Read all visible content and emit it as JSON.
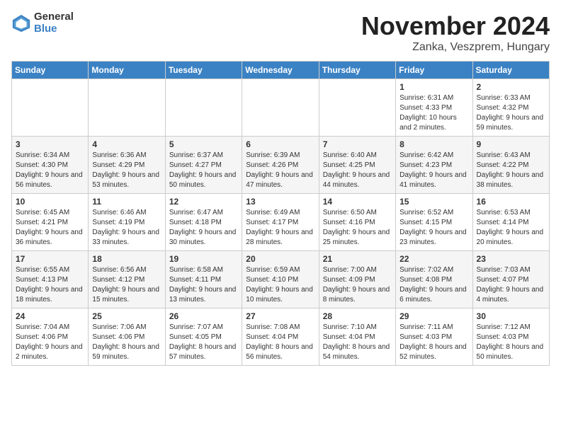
{
  "logo": {
    "general": "General",
    "blue": "Blue"
  },
  "title": {
    "month": "November 2024",
    "location": "Zanka, Veszprem, Hungary"
  },
  "headers": [
    "Sunday",
    "Monday",
    "Tuesday",
    "Wednesday",
    "Thursday",
    "Friday",
    "Saturday"
  ],
  "weeks": [
    [
      {
        "day": "",
        "sunrise": "",
        "sunset": "",
        "daylight": ""
      },
      {
        "day": "",
        "sunrise": "",
        "sunset": "",
        "daylight": ""
      },
      {
        "day": "",
        "sunrise": "",
        "sunset": "",
        "daylight": ""
      },
      {
        "day": "",
        "sunrise": "",
        "sunset": "",
        "daylight": ""
      },
      {
        "day": "",
        "sunrise": "",
        "sunset": "",
        "daylight": ""
      },
      {
        "day": "1",
        "sunrise": "Sunrise: 6:31 AM",
        "sunset": "Sunset: 4:33 PM",
        "daylight": "Daylight: 10 hours and 2 minutes."
      },
      {
        "day": "2",
        "sunrise": "Sunrise: 6:33 AM",
        "sunset": "Sunset: 4:32 PM",
        "daylight": "Daylight: 9 hours and 59 minutes."
      }
    ],
    [
      {
        "day": "3",
        "sunrise": "Sunrise: 6:34 AM",
        "sunset": "Sunset: 4:30 PM",
        "daylight": "Daylight: 9 hours and 56 minutes."
      },
      {
        "day": "4",
        "sunrise": "Sunrise: 6:36 AM",
        "sunset": "Sunset: 4:29 PM",
        "daylight": "Daylight: 9 hours and 53 minutes."
      },
      {
        "day": "5",
        "sunrise": "Sunrise: 6:37 AM",
        "sunset": "Sunset: 4:27 PM",
        "daylight": "Daylight: 9 hours and 50 minutes."
      },
      {
        "day": "6",
        "sunrise": "Sunrise: 6:39 AM",
        "sunset": "Sunset: 4:26 PM",
        "daylight": "Daylight: 9 hours and 47 minutes."
      },
      {
        "day": "7",
        "sunrise": "Sunrise: 6:40 AM",
        "sunset": "Sunset: 4:25 PM",
        "daylight": "Daylight: 9 hours and 44 minutes."
      },
      {
        "day": "8",
        "sunrise": "Sunrise: 6:42 AM",
        "sunset": "Sunset: 4:23 PM",
        "daylight": "Daylight: 9 hours and 41 minutes."
      },
      {
        "day": "9",
        "sunrise": "Sunrise: 6:43 AM",
        "sunset": "Sunset: 4:22 PM",
        "daylight": "Daylight: 9 hours and 38 minutes."
      }
    ],
    [
      {
        "day": "10",
        "sunrise": "Sunrise: 6:45 AM",
        "sunset": "Sunset: 4:21 PM",
        "daylight": "Daylight: 9 hours and 36 minutes."
      },
      {
        "day": "11",
        "sunrise": "Sunrise: 6:46 AM",
        "sunset": "Sunset: 4:19 PM",
        "daylight": "Daylight: 9 hours and 33 minutes."
      },
      {
        "day": "12",
        "sunrise": "Sunrise: 6:47 AM",
        "sunset": "Sunset: 4:18 PM",
        "daylight": "Daylight: 9 hours and 30 minutes."
      },
      {
        "day": "13",
        "sunrise": "Sunrise: 6:49 AM",
        "sunset": "Sunset: 4:17 PM",
        "daylight": "Daylight: 9 hours and 28 minutes."
      },
      {
        "day": "14",
        "sunrise": "Sunrise: 6:50 AM",
        "sunset": "Sunset: 4:16 PM",
        "daylight": "Daylight: 9 hours and 25 minutes."
      },
      {
        "day": "15",
        "sunrise": "Sunrise: 6:52 AM",
        "sunset": "Sunset: 4:15 PM",
        "daylight": "Daylight: 9 hours and 23 minutes."
      },
      {
        "day": "16",
        "sunrise": "Sunrise: 6:53 AM",
        "sunset": "Sunset: 4:14 PM",
        "daylight": "Daylight: 9 hours and 20 minutes."
      }
    ],
    [
      {
        "day": "17",
        "sunrise": "Sunrise: 6:55 AM",
        "sunset": "Sunset: 4:13 PM",
        "daylight": "Daylight: 9 hours and 18 minutes."
      },
      {
        "day": "18",
        "sunrise": "Sunrise: 6:56 AM",
        "sunset": "Sunset: 4:12 PM",
        "daylight": "Daylight: 9 hours and 15 minutes."
      },
      {
        "day": "19",
        "sunrise": "Sunrise: 6:58 AM",
        "sunset": "Sunset: 4:11 PM",
        "daylight": "Daylight: 9 hours and 13 minutes."
      },
      {
        "day": "20",
        "sunrise": "Sunrise: 6:59 AM",
        "sunset": "Sunset: 4:10 PM",
        "daylight": "Daylight: 9 hours and 10 minutes."
      },
      {
        "day": "21",
        "sunrise": "Sunrise: 7:00 AM",
        "sunset": "Sunset: 4:09 PM",
        "daylight": "Daylight: 9 hours and 8 minutes."
      },
      {
        "day": "22",
        "sunrise": "Sunrise: 7:02 AM",
        "sunset": "Sunset: 4:08 PM",
        "daylight": "Daylight: 9 hours and 6 minutes."
      },
      {
        "day": "23",
        "sunrise": "Sunrise: 7:03 AM",
        "sunset": "Sunset: 4:07 PM",
        "daylight": "Daylight: 9 hours and 4 minutes."
      }
    ],
    [
      {
        "day": "24",
        "sunrise": "Sunrise: 7:04 AM",
        "sunset": "Sunset: 4:06 PM",
        "daylight": "Daylight: 9 hours and 2 minutes."
      },
      {
        "day": "25",
        "sunrise": "Sunrise: 7:06 AM",
        "sunset": "Sunset: 4:06 PM",
        "daylight": "Daylight: 8 hours and 59 minutes."
      },
      {
        "day": "26",
        "sunrise": "Sunrise: 7:07 AM",
        "sunset": "Sunset: 4:05 PM",
        "daylight": "Daylight: 8 hours and 57 minutes."
      },
      {
        "day": "27",
        "sunrise": "Sunrise: 7:08 AM",
        "sunset": "Sunset: 4:04 PM",
        "daylight": "Daylight: 8 hours and 56 minutes."
      },
      {
        "day": "28",
        "sunrise": "Sunrise: 7:10 AM",
        "sunset": "Sunset: 4:04 PM",
        "daylight": "Daylight: 8 hours and 54 minutes."
      },
      {
        "day": "29",
        "sunrise": "Sunrise: 7:11 AM",
        "sunset": "Sunset: 4:03 PM",
        "daylight": "Daylight: 8 hours and 52 minutes."
      },
      {
        "day": "30",
        "sunrise": "Sunrise: 7:12 AM",
        "sunset": "Sunset: 4:03 PM",
        "daylight": "Daylight: 8 hours and 50 minutes."
      }
    ]
  ]
}
